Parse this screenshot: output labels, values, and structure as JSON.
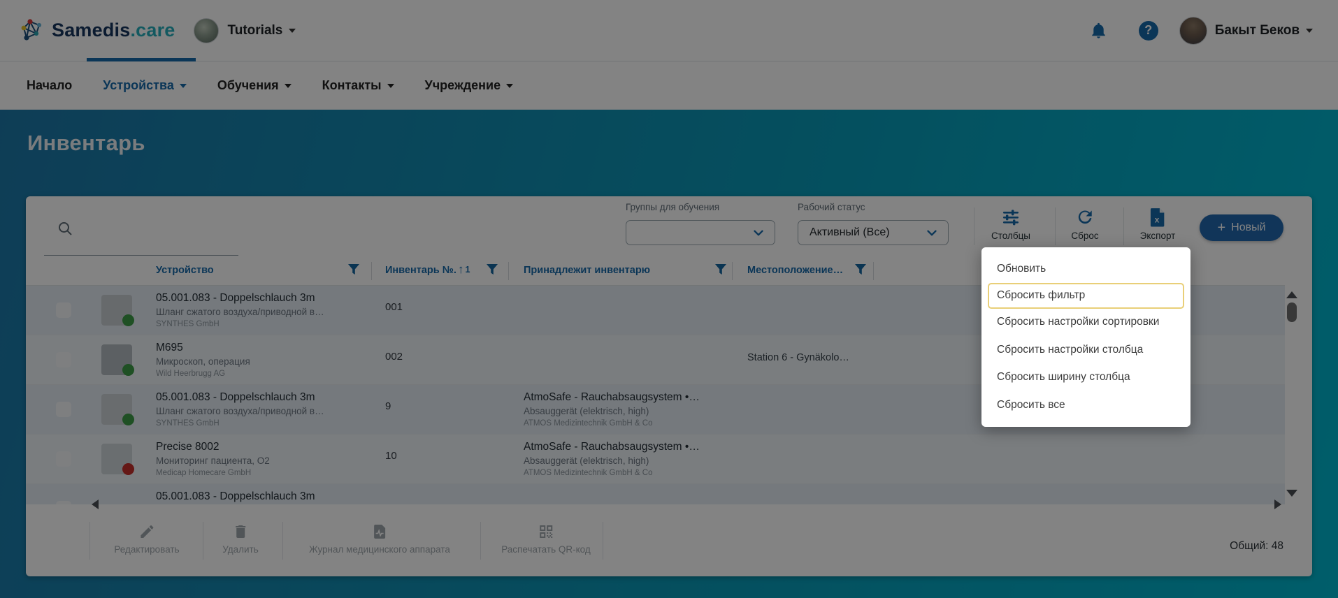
{
  "brand": {
    "name_primary": "Samedis",
    "name_secondary": ".care",
    "workspace": "Tutorials"
  },
  "topbar": {
    "user_name": "Бакыт Беков"
  },
  "nav": {
    "items": [
      {
        "label": "Начало"
      },
      {
        "label": "Устройства"
      },
      {
        "label": "Обучения"
      },
      {
        "label": "Контакты"
      },
      {
        "label": "Учреждение"
      }
    ]
  },
  "page": {
    "title": "Инвентарь"
  },
  "filters": {
    "search_value": "",
    "training_groups": {
      "label": "Группы для обучения",
      "value": ""
    },
    "work_status": {
      "label": "Рабочий статус",
      "value": "Активный (Все)"
    }
  },
  "actions": {
    "columns": "Столбцы",
    "reset": "Сброс",
    "export": "Экспорт",
    "new": "Новый",
    "plus": "+"
  },
  "table": {
    "columns": [
      {
        "label": "Устройство"
      },
      {
        "label": "Инвентарь №."
      },
      {
        "label": "Принадлежит инвентарю"
      },
      {
        "label": "Местоположение…"
      }
    ],
    "sort_arrow": "↑",
    "sort_order": "1",
    "rows": [
      {
        "name": "05.001.083 - Doppelschlauch 3m",
        "type": "Шланг сжатого воздуха/приводной в…",
        "manufacturer": "SYNTHES GmbH",
        "inventory_no": "001",
        "location": "",
        "status": "green"
      },
      {
        "name": "M695",
        "type": "Микроскоп, операция",
        "manufacturer": "Wild Heerbrugg AG",
        "inventory_no": "002",
        "location": "Station 6 - Gynäkolo…",
        "status": "green"
      },
      {
        "name": "05.001.083 - Doppelschlauch 3m",
        "type": "Шланг сжатого воздуха/приводной в…",
        "manufacturer": "SYNTHES GmbH",
        "inventory_no": "9",
        "belongs_name": "AtmoSafe - Rauchabsaugsystem •…",
        "belongs_type": "Absauggerät (elektrisch, high)",
        "belongs_manufacturer": "ATMOS Medizintechnik GmbH & Co",
        "status": "green"
      },
      {
        "name": "Precise 8002",
        "type": "Мониторинг пациента, O2",
        "manufacturer": "Medicap Homecare GmbH",
        "inventory_no": "10",
        "belongs_name": "AtmoSafe - Rauchabsaugsystem •…",
        "belongs_type": "Absauggerät (elektrisch, high)",
        "belongs_manufacturer": "ATMOS Medizintechnik GmbH & Co",
        "status": "red"
      },
      {
        "name": "05.001.083 - Doppelschlauch 3m"
      }
    ]
  },
  "menu": {
    "items": [
      {
        "label": "Обновить"
      },
      {
        "label": "Сбросить фильтр",
        "highlighted": true
      },
      {
        "label": "Сбросить настройки сортировки"
      },
      {
        "label": "Сбросить настройки столбца"
      },
      {
        "label": "Сбросить ширину столбца"
      },
      {
        "label": "Сбросить все"
      }
    ]
  },
  "footer": {
    "edit": "Редактировать",
    "delete": "Удалить",
    "device_log": "Журнал медицинского аппарата",
    "print_qr": "Распечатать QR-код",
    "total": "Общий: 48"
  },
  "colors": {
    "primary": "#1769aa",
    "accent_teal": "#00b7cf",
    "highlight_border": "#e9cf78",
    "status_green": "#3d9c46",
    "status_red": "#c4302b"
  }
}
